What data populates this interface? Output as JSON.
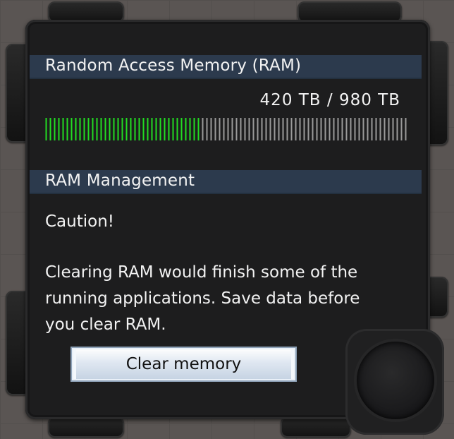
{
  "ram": {
    "section_title": "Random Access Memory (RAM)",
    "usage_text": "420 TB / 980 TB",
    "used_tb": 420,
    "total_tb": 980,
    "fill_color": "#22dd22",
    "empty_color": "#9a9a9a"
  },
  "management": {
    "section_title": "RAM Management",
    "caution_label": "Caution!",
    "warning_lines": [
      "Clearing RAM would finish some of the",
      "running applications. Save data before",
      "you clear RAM."
    ],
    "clear_button_label": "Clear memory"
  }
}
